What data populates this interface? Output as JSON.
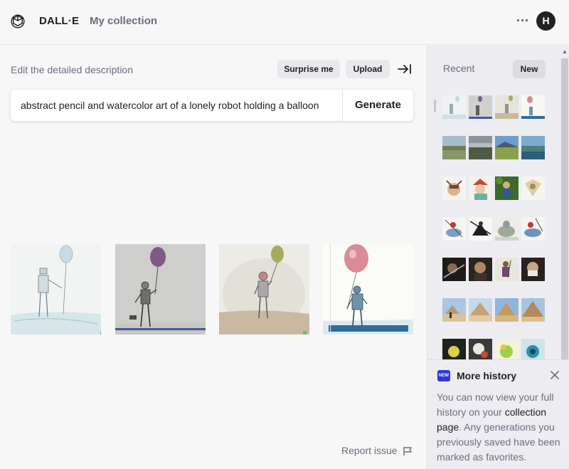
{
  "header": {
    "brand": "DALL·E",
    "collection_link": "My collection",
    "more_icon": "ellipsis-icon",
    "avatar_initial": "H"
  },
  "editor": {
    "label": "Edit the detailed description",
    "surprise_label": "Surprise me",
    "upload_label": "Upload",
    "prompt_value": "abstract pencil and watercolor art of a lonely robot holding a balloon",
    "generate_label": "Generate"
  },
  "results": [
    {
      "balloon_color": "#b9cfdc"
    },
    {
      "balloon_color": "#7f5a86"
    },
    {
      "balloon_color": "#a5ad5c"
    },
    {
      "balloon_color": "#d98b96"
    }
  ],
  "footer": {
    "report_label": "Report issue"
  },
  "recent": {
    "title": "Recent",
    "new_label": "New"
  },
  "history_card": {
    "badge": "NEW",
    "title": "More history",
    "text_1": "You can now view your full history on your ",
    "link": "collection page",
    "text_2": ". Any generations you previously saved have been marked as favorites."
  },
  "colors": {
    "accent_badge": "#2d36e0",
    "text_primary": "#202123",
    "text_secondary": "#6e6e80"
  }
}
